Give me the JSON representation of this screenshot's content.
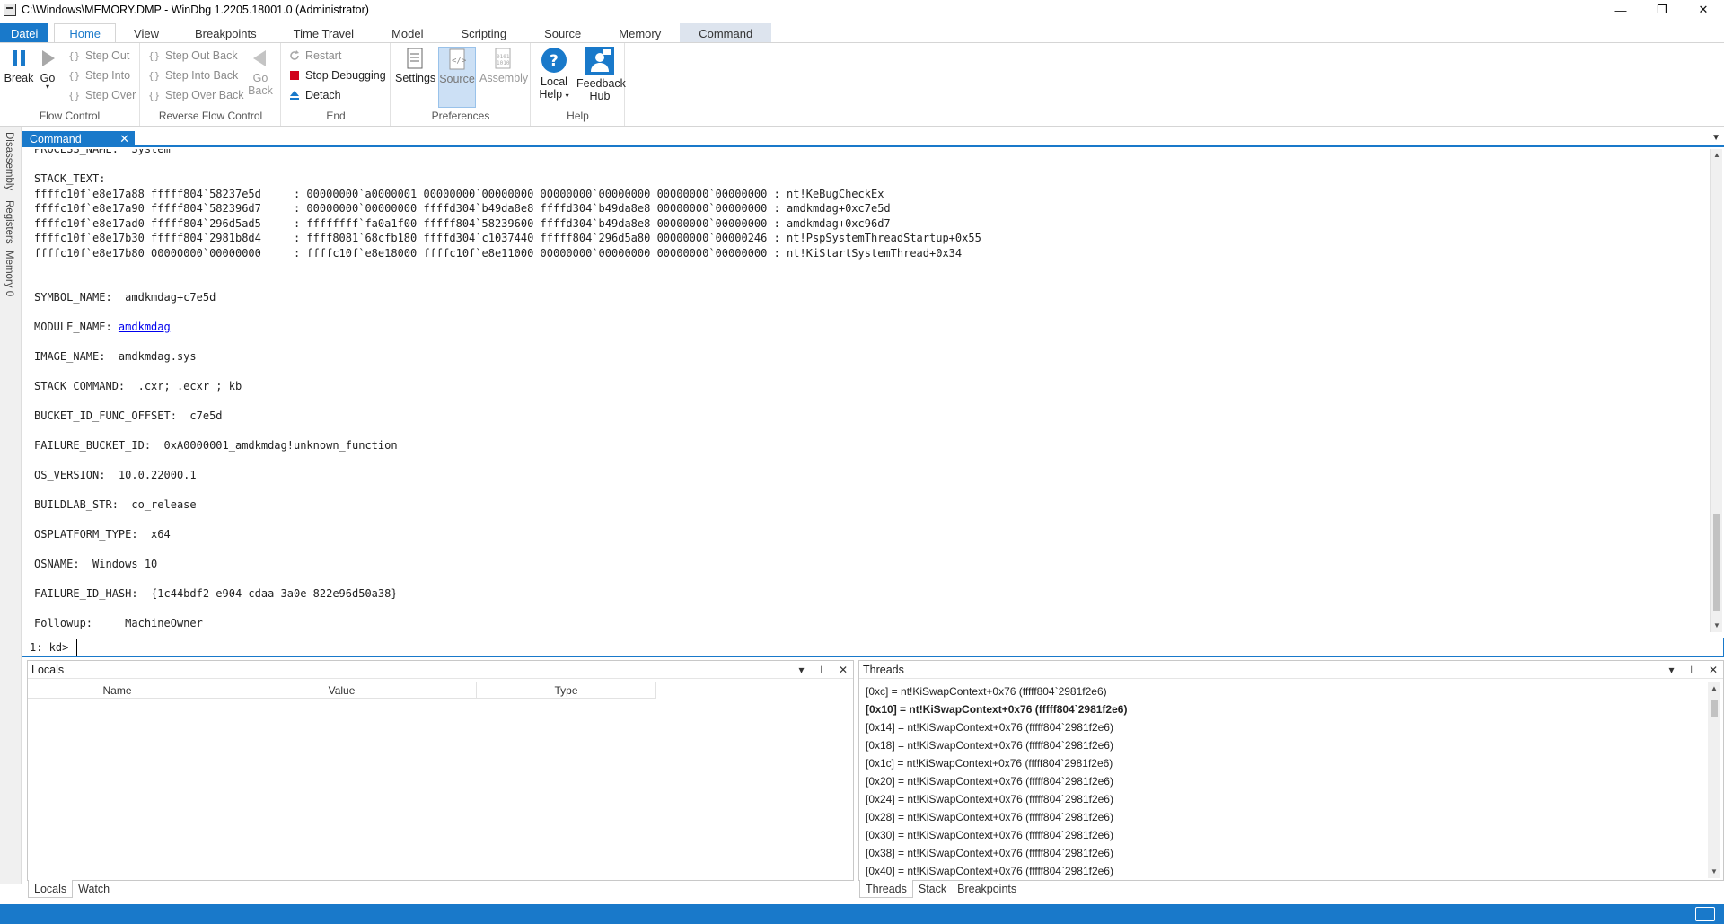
{
  "window": {
    "title": "C:\\Windows\\MEMORY.DMP - WinDbg 1.2205.18001.0 (Administrator)",
    "minimize": "—",
    "maximize": "❐",
    "close": "✕"
  },
  "ribbon_tabs": [
    "Datei",
    "Home",
    "View",
    "Breakpoints",
    "Time Travel",
    "Model",
    "Scripting",
    "Source",
    "Memory",
    "Command"
  ],
  "ribbon": {
    "flow_control": {
      "label": "Flow Control",
      "break": "Break",
      "go": "Go",
      "step_out": "Step Out",
      "step_into": "Step Into",
      "step_over": "Step Over"
    },
    "reverse_flow": {
      "label": "Reverse Flow Control",
      "step_out_back": "Step Out Back",
      "step_into_back": "Step Into Back",
      "step_over_back": "Step Over Back",
      "go_back_1": "Go",
      "go_back_2": "Back"
    },
    "end": {
      "label": "End",
      "restart": "Restart",
      "stop": "Stop Debugging",
      "detach": "Detach"
    },
    "preferences": {
      "label": "Preferences",
      "settings": "Settings",
      "source": "Source",
      "assembly": "Assembly"
    },
    "help": {
      "label": "Help",
      "local_help_1": "Local",
      "local_help_2": "Help",
      "feedback_1": "Feedback",
      "feedback_2": "Hub"
    }
  },
  "rail": {
    "disassembly": "Disassembly",
    "registers": "Registers",
    "memory": "Memory 0"
  },
  "command": {
    "tab": "Command",
    "prompt": "1: kd>",
    "lines": [
      "PROCESS_NAME:  System",
      "",
      "STACK_TEXT:  ",
      "ffffc10f`e8e17a88 fffff804`58237e5d     : 00000000`a0000001 00000000`00000000 00000000`00000000 00000000`00000000 : nt!KeBugCheckEx",
      "ffffc10f`e8e17a90 fffff804`582396d7     : 00000000`00000000 ffffd304`b49da8e8 ffffd304`b49da8e8 00000000`00000000 : amdkmdag+0xc7e5d",
      "ffffc10f`e8e17ad0 fffff804`296d5ad5     : ffffffff`fa0a1f00 fffff804`58239600 ffffd304`b49da8e8 00000000`00000000 : amdkmdag+0xc96d7",
      "ffffc10f`e8e17b30 fffff804`2981b8d4     : ffff8081`68cfb180 ffffd304`c1037440 fffff804`296d5a80 00000000`00000246 : nt!PspSystemThreadStartup+0x55",
      "ffffc10f`e8e17b80 00000000`00000000     : ffffc10f`e8e18000 ffffc10f`e8e11000 00000000`00000000 00000000`00000000 : nt!KiStartSystemThread+0x34",
      "",
      "",
      "SYMBOL_NAME:  amdkmdag+c7e5d",
      "",
      "MODULE_NAME: ",
      "",
      "IMAGE_NAME:  amdkmdag.sys",
      "",
      "STACK_COMMAND:  .cxr; .ecxr ; kb",
      "",
      "BUCKET_ID_FUNC_OFFSET:  c7e5d",
      "",
      "FAILURE_BUCKET_ID:  0xA0000001_amdkmdag!unknown_function",
      "",
      "OS_VERSION:  10.0.22000.1",
      "",
      "BUILDLAB_STR:  co_release",
      "",
      "OSPLATFORM_TYPE:  x64",
      "",
      "OSNAME:  Windows 10",
      "",
      "FAILURE_ID_HASH:  {1c44bdf2-e904-cdaa-3a0e-822e96d50a38}",
      "",
      "Followup:     MachineOwner"
    ],
    "module_link": "amdkmdag"
  },
  "locals": {
    "title": "Locals",
    "columns": [
      "Name",
      "Value",
      "Type"
    ],
    "tabs": [
      "Locals",
      "Watch"
    ]
  },
  "threads": {
    "title": "Threads",
    "items": [
      "[0xc] = nt!KiSwapContext+0x76 (fffff804`2981f2e6)",
      "[0x10] = nt!KiSwapContext+0x76 (fffff804`2981f2e6)",
      "[0x14] = nt!KiSwapContext+0x76 (fffff804`2981f2e6)",
      "[0x18] = nt!KiSwapContext+0x76 (fffff804`2981f2e6)",
      "[0x1c] = nt!KiSwapContext+0x76 (fffff804`2981f2e6)",
      "[0x20] = nt!KiSwapContext+0x76 (fffff804`2981f2e6)",
      "[0x24] = nt!KiSwapContext+0x76 (fffff804`2981f2e6)",
      "[0x28] = nt!KiSwapContext+0x76 (fffff804`2981f2e6)",
      "[0x30] = nt!KiSwapContext+0x76 (fffff804`2981f2e6)",
      "[0x38] = nt!KiSwapContext+0x76 (fffff804`2981f2e6)",
      "[0x40] = nt!KiSwapContext+0x76 (fffff804`2981f2e6)"
    ],
    "bold_index": 1,
    "tabs": [
      "Threads",
      "Stack",
      "Breakpoints"
    ]
  },
  "colors": {
    "accent": "#1979ca",
    "stop_red": "#d0021b"
  }
}
